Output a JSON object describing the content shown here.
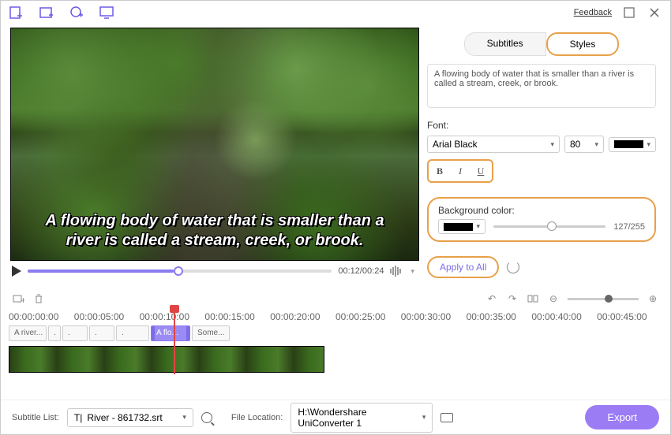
{
  "topbar": {
    "feedback": "Feedback"
  },
  "preview": {
    "subtitle_text": "A flowing body of water that is smaller than a river is called a stream, creek, or brook.",
    "time": "00:12/00:24"
  },
  "tabs": {
    "subtitles": "Subtitles",
    "styles": "Styles"
  },
  "editor": {
    "text": "A flowing body of water that is smaller than a river is called a stream, creek, or brook.",
    "font_label": "Font:",
    "font_family": "Arial Black",
    "font_size": "80",
    "bold": "B",
    "italic": "I",
    "underline": "U",
    "bg_label": "Background color:",
    "opacity": "127/255",
    "apply": "Apply to All"
  },
  "ruler": [
    "00:00:00:00",
    "00:00:05:00",
    "00:00:10:00",
    "00:00:15:00",
    "00:00:20:00",
    "00:00:25:00",
    "00:00:30:00",
    "00:00:35:00",
    "00:00:40:00",
    "00:00:45:00"
  ],
  "clips": {
    "c0": "A river...",
    "c1": ".",
    "c2": ".",
    "c3": ".",
    "c4": ".",
    "active": "A flo...",
    "c5": "Some..."
  },
  "bottom": {
    "subtitle_list_label": "Subtitle List:",
    "subtitle_file": "River - 861732.srt",
    "file_loc_label": "File Location:",
    "file_loc": "H:\\Wondershare UniConverter 1",
    "export": "Export"
  }
}
